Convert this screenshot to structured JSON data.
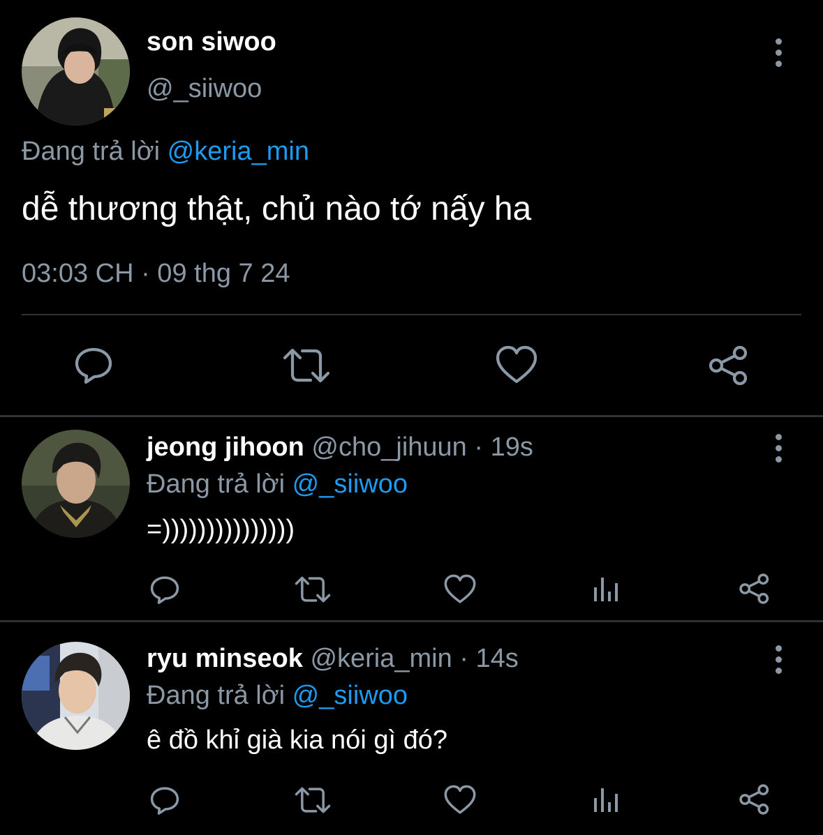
{
  "main_tweet": {
    "display_name": "son siwoo",
    "handle": "@_siiwoo",
    "replying_prefix": "Đang trả lời",
    "replying_to": "@keria_min",
    "text": "dễ thương thật, chủ nào tớ nấy ha",
    "timestamp": "03:03 CH · 09 thg 7 24",
    "actions": [
      "reply-icon",
      "retweet-icon",
      "like-icon",
      "share-icon"
    ]
  },
  "replies": [
    {
      "display_name": "jeong jihoon",
      "handle": "@cho_jihuun",
      "time": "· 19s",
      "replying_prefix": "Đang trả lời",
      "replying_to": "@_siiwoo",
      "text": "=)))))))))))))))",
      "actions": [
        "reply-icon",
        "retweet-icon",
        "like-icon",
        "views-icon",
        "share-icon"
      ]
    },
    {
      "display_name": "ryu minseok",
      "handle": "@keria_min",
      "time": "· 14s",
      "replying_prefix": "Đang trả lời",
      "replying_to": "@_siiwoo",
      "text": "ê đồ khỉ già kia nói gì đó?",
      "actions": [
        "reply-icon",
        "retweet-icon",
        "like-icon",
        "views-icon",
        "share-icon"
      ]
    }
  ],
  "colors": {
    "background": "#000000",
    "text": "#e7e9ea",
    "muted": "#8b98a5",
    "link": "#1d9bf0",
    "divider": "#2f3336"
  }
}
